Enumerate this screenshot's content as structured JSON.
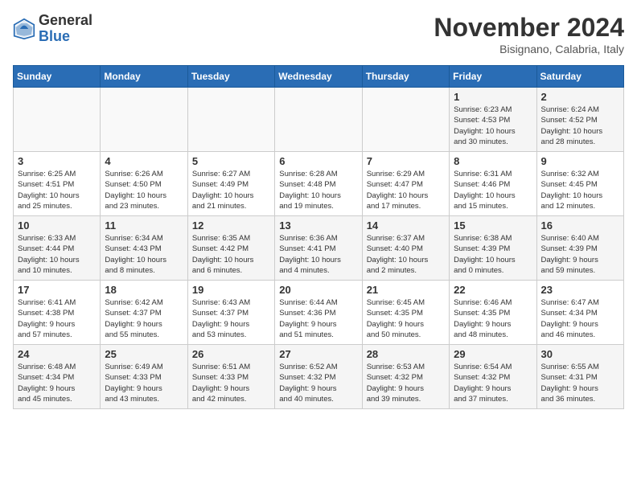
{
  "logo": {
    "general": "General",
    "blue": "Blue"
  },
  "title": "November 2024",
  "location": "Bisignano, Calabria, Italy",
  "days_of_week": [
    "Sunday",
    "Monday",
    "Tuesday",
    "Wednesday",
    "Thursday",
    "Friday",
    "Saturday"
  ],
  "weeks": [
    [
      {
        "day": "",
        "info": ""
      },
      {
        "day": "",
        "info": ""
      },
      {
        "day": "",
        "info": ""
      },
      {
        "day": "",
        "info": ""
      },
      {
        "day": "",
        "info": ""
      },
      {
        "day": "1",
        "info": "Sunrise: 6:23 AM\nSunset: 4:53 PM\nDaylight: 10 hours\nand 30 minutes."
      },
      {
        "day": "2",
        "info": "Sunrise: 6:24 AM\nSunset: 4:52 PM\nDaylight: 10 hours\nand 28 minutes."
      }
    ],
    [
      {
        "day": "3",
        "info": "Sunrise: 6:25 AM\nSunset: 4:51 PM\nDaylight: 10 hours\nand 25 minutes."
      },
      {
        "day": "4",
        "info": "Sunrise: 6:26 AM\nSunset: 4:50 PM\nDaylight: 10 hours\nand 23 minutes."
      },
      {
        "day": "5",
        "info": "Sunrise: 6:27 AM\nSunset: 4:49 PM\nDaylight: 10 hours\nand 21 minutes."
      },
      {
        "day": "6",
        "info": "Sunrise: 6:28 AM\nSunset: 4:48 PM\nDaylight: 10 hours\nand 19 minutes."
      },
      {
        "day": "7",
        "info": "Sunrise: 6:29 AM\nSunset: 4:47 PM\nDaylight: 10 hours\nand 17 minutes."
      },
      {
        "day": "8",
        "info": "Sunrise: 6:31 AM\nSunset: 4:46 PM\nDaylight: 10 hours\nand 15 minutes."
      },
      {
        "day": "9",
        "info": "Sunrise: 6:32 AM\nSunset: 4:45 PM\nDaylight: 10 hours\nand 12 minutes."
      }
    ],
    [
      {
        "day": "10",
        "info": "Sunrise: 6:33 AM\nSunset: 4:44 PM\nDaylight: 10 hours\nand 10 minutes."
      },
      {
        "day": "11",
        "info": "Sunrise: 6:34 AM\nSunset: 4:43 PM\nDaylight: 10 hours\nand 8 minutes."
      },
      {
        "day": "12",
        "info": "Sunrise: 6:35 AM\nSunset: 4:42 PM\nDaylight: 10 hours\nand 6 minutes."
      },
      {
        "day": "13",
        "info": "Sunrise: 6:36 AM\nSunset: 4:41 PM\nDaylight: 10 hours\nand 4 minutes."
      },
      {
        "day": "14",
        "info": "Sunrise: 6:37 AM\nSunset: 4:40 PM\nDaylight: 10 hours\nand 2 minutes."
      },
      {
        "day": "15",
        "info": "Sunrise: 6:38 AM\nSunset: 4:39 PM\nDaylight: 10 hours\nand 0 minutes."
      },
      {
        "day": "16",
        "info": "Sunrise: 6:40 AM\nSunset: 4:39 PM\nDaylight: 9 hours\nand 59 minutes."
      }
    ],
    [
      {
        "day": "17",
        "info": "Sunrise: 6:41 AM\nSunset: 4:38 PM\nDaylight: 9 hours\nand 57 minutes."
      },
      {
        "day": "18",
        "info": "Sunrise: 6:42 AM\nSunset: 4:37 PM\nDaylight: 9 hours\nand 55 minutes."
      },
      {
        "day": "19",
        "info": "Sunrise: 6:43 AM\nSunset: 4:37 PM\nDaylight: 9 hours\nand 53 minutes."
      },
      {
        "day": "20",
        "info": "Sunrise: 6:44 AM\nSunset: 4:36 PM\nDaylight: 9 hours\nand 51 minutes."
      },
      {
        "day": "21",
        "info": "Sunrise: 6:45 AM\nSunset: 4:35 PM\nDaylight: 9 hours\nand 50 minutes."
      },
      {
        "day": "22",
        "info": "Sunrise: 6:46 AM\nSunset: 4:35 PM\nDaylight: 9 hours\nand 48 minutes."
      },
      {
        "day": "23",
        "info": "Sunrise: 6:47 AM\nSunset: 4:34 PM\nDaylight: 9 hours\nand 46 minutes."
      }
    ],
    [
      {
        "day": "24",
        "info": "Sunrise: 6:48 AM\nSunset: 4:34 PM\nDaylight: 9 hours\nand 45 minutes."
      },
      {
        "day": "25",
        "info": "Sunrise: 6:49 AM\nSunset: 4:33 PM\nDaylight: 9 hours\nand 43 minutes."
      },
      {
        "day": "26",
        "info": "Sunrise: 6:51 AM\nSunset: 4:33 PM\nDaylight: 9 hours\nand 42 minutes."
      },
      {
        "day": "27",
        "info": "Sunrise: 6:52 AM\nSunset: 4:32 PM\nDaylight: 9 hours\nand 40 minutes."
      },
      {
        "day": "28",
        "info": "Sunrise: 6:53 AM\nSunset: 4:32 PM\nDaylight: 9 hours\nand 39 minutes."
      },
      {
        "day": "29",
        "info": "Sunrise: 6:54 AM\nSunset: 4:32 PM\nDaylight: 9 hours\nand 37 minutes."
      },
      {
        "day": "30",
        "info": "Sunrise: 6:55 AM\nSunset: 4:31 PM\nDaylight: 9 hours\nand 36 minutes."
      }
    ]
  ]
}
